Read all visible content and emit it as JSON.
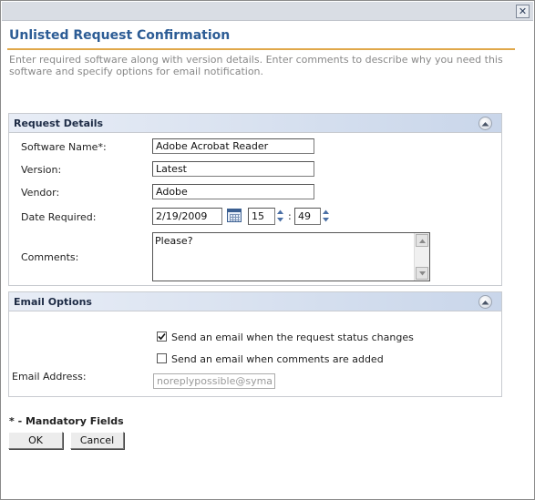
{
  "dialog": {
    "title": "Unlisted Request Confirmation",
    "description": "Enter required software along with version details. Enter comments to describe why you need this software and specify options for email notification.",
    "close_glyph": "✕"
  },
  "request_details": {
    "heading": "Request Details",
    "software_name_label": "Software Name*:",
    "software_name_value": "Adobe Acrobat Reader",
    "version_label": "Version:",
    "version_value": "Latest",
    "vendor_label": "Vendor:",
    "vendor_value": "Adobe",
    "date_required_label": "Date Required:",
    "date_value": "2/19/2009",
    "hour_value": "15",
    "time_separator": ":",
    "minute_value": "49",
    "comments_label": "Comments:",
    "comments_value": "Please?"
  },
  "email_options": {
    "heading": "Email Options",
    "status_change_label": "Send an email when the request status changes",
    "status_change_checked": true,
    "comments_added_label": "Send an email when comments are added",
    "comments_added_checked": false,
    "email_address_label": "Email Address:",
    "email_address_value": "noreplypossible@syma"
  },
  "footer": {
    "mandatory_note": "* - Mandatory Fields",
    "ok_label": "OK",
    "cancel_label": "Cancel"
  },
  "colors": {
    "title": "#2c5c95",
    "rule": "#e0a84a",
    "section_gradient_start": "#e8edf6",
    "section_gradient_end": "#c9d6ea"
  }
}
